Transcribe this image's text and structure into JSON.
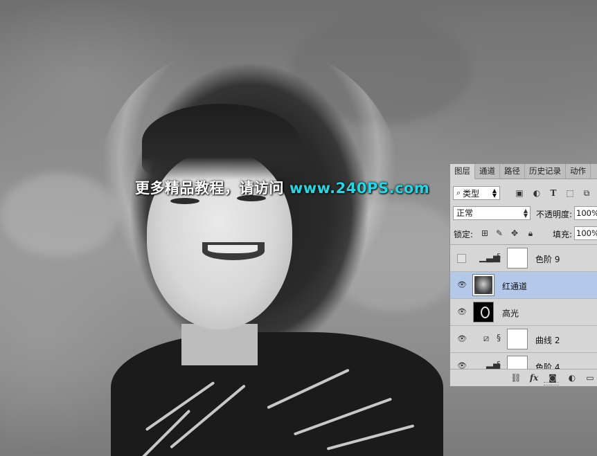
{
  "watermark": {
    "text_cn": "更多精品教程，请访问",
    "text_url": "www.240PS.com",
    "url_color": "#20d8e6"
  },
  "panel": {
    "tabs": [
      "图层",
      "通道",
      "路径",
      "历史记录",
      "动作"
    ],
    "active_tab": "图层",
    "filter": {
      "search_icon": "search-icon",
      "value": "类型",
      "filter_icons": [
        "image-filter-icon",
        "adjustment-filter-icon",
        "type-filter-icon",
        "shape-filter-icon",
        "smart-object-filter-icon"
      ]
    },
    "blend_mode": "正常",
    "opacity_label": "不透明度:",
    "opacity_value": "100%",
    "lock_label": "锁定:",
    "fill_label": "填充:",
    "fill_value": "100%",
    "layers": [
      {
        "name": "色阶 9",
        "visible": false,
        "type": "levels-adjustment",
        "selected": false
      },
      {
        "name": "红通道",
        "visible": true,
        "type": "pixel",
        "selected": true
      },
      {
        "name": "高光",
        "visible": true,
        "type": "mask",
        "selected": false
      },
      {
        "name": "曲线 2",
        "visible": true,
        "type": "curves-adjustment",
        "selected": false
      },
      {
        "name": "色阶 4",
        "visible": true,
        "type": "levels-adjustment",
        "selected": false
      }
    ],
    "selected_color": "#b4c8ea",
    "footer_icons": [
      "link-layers-icon",
      "fx-icon",
      "add-mask-icon",
      "new-adjustment-icon",
      "new-group-icon"
    ],
    "fx_label": "fx"
  }
}
